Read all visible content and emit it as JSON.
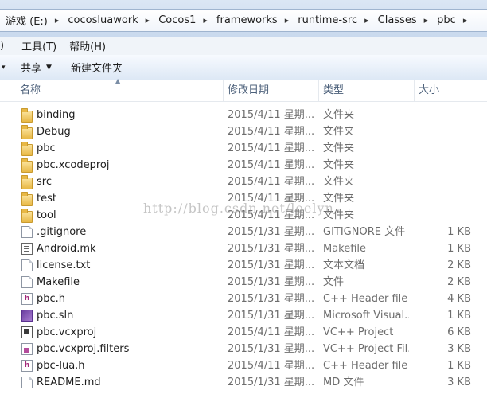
{
  "address": {
    "crumbs": [
      "游戏 (E:)",
      "cocosluawork",
      "Cocos1",
      "frameworks",
      "runtime-src",
      "Classes",
      "pbc"
    ]
  },
  "menu": {
    "cut_item": ")",
    "items": [
      "工具(T)",
      "帮助(H)"
    ]
  },
  "toolbar": {
    "share_label": "共享",
    "new_folder_label": "新建文件夹"
  },
  "columns": {
    "name": "名称",
    "date": "修改日期",
    "type": "类型",
    "size": "大小"
  },
  "files": [
    {
      "name": "binding",
      "date": "2015/4/11 星期...",
      "type": "文件夹",
      "size": "",
      "icon": "folder-icon"
    },
    {
      "name": "Debug",
      "date": "2015/4/11 星期...",
      "type": "文件夹",
      "size": "",
      "icon": "folder-icon"
    },
    {
      "name": "pbc",
      "date": "2015/4/11 星期...",
      "type": "文件夹",
      "size": "",
      "icon": "folder-icon"
    },
    {
      "name": "pbc.xcodeproj",
      "date": "2015/4/11 星期...",
      "type": "文件夹",
      "size": "",
      "icon": "folder-icon"
    },
    {
      "name": "src",
      "date": "2015/4/11 星期...",
      "type": "文件夹",
      "size": "",
      "icon": "folder-icon"
    },
    {
      "name": "test",
      "date": "2015/4/11 星期...",
      "type": "文件夹",
      "size": "",
      "icon": "folder-icon"
    },
    {
      "name": "tool",
      "date": "2015/4/11 星期...",
      "type": "文件夹",
      "size": "",
      "icon": "folder-icon"
    },
    {
      "name": ".gitignore",
      "date": "2015/1/31 星期...",
      "type": "GITIGNORE 文件",
      "size": "1 KB",
      "icon": "file-icon"
    },
    {
      "name": "Android.mk",
      "date": "2015/1/31 星期...",
      "type": "Makefile",
      "size": "1 KB",
      "icon": "makefile-icon"
    },
    {
      "name": "license.txt",
      "date": "2015/1/31 星期...",
      "type": "文本文档",
      "size": "2 KB",
      "icon": "file-icon"
    },
    {
      "name": "Makefile",
      "date": "2015/1/31 星期...",
      "type": "文件",
      "size": "2 KB",
      "icon": "file-icon"
    },
    {
      "name": "pbc.h",
      "date": "2015/1/31 星期...",
      "type": "C++ Header file",
      "size": "4 KB",
      "icon": "header-icon"
    },
    {
      "name": "pbc.sln",
      "date": "2015/1/31 星期...",
      "type": "Microsoft Visual...",
      "size": "1 KB",
      "icon": "solution-icon"
    },
    {
      "name": "pbc.vcxproj",
      "date": "2015/4/11 星期...",
      "type": "VC++ Project",
      "size": "6 KB",
      "icon": "vcxproj-icon"
    },
    {
      "name": "pbc.vcxproj.filters",
      "date": "2015/1/31 星期...",
      "type": "VC++ Project Fil...",
      "size": "3 KB",
      "icon": "filters-icon"
    },
    {
      "name": "pbc-lua.h",
      "date": "2015/4/11 星期...",
      "type": "C++ Header file",
      "size": "1 KB",
      "icon": "header-icon"
    },
    {
      "name": "README.md",
      "date": "2015/1/31 星期...",
      "type": "MD 文件",
      "size": "3 KB",
      "icon": "file-icon"
    }
  ],
  "watermark": "http://blog.csdn.net/leelyn"
}
